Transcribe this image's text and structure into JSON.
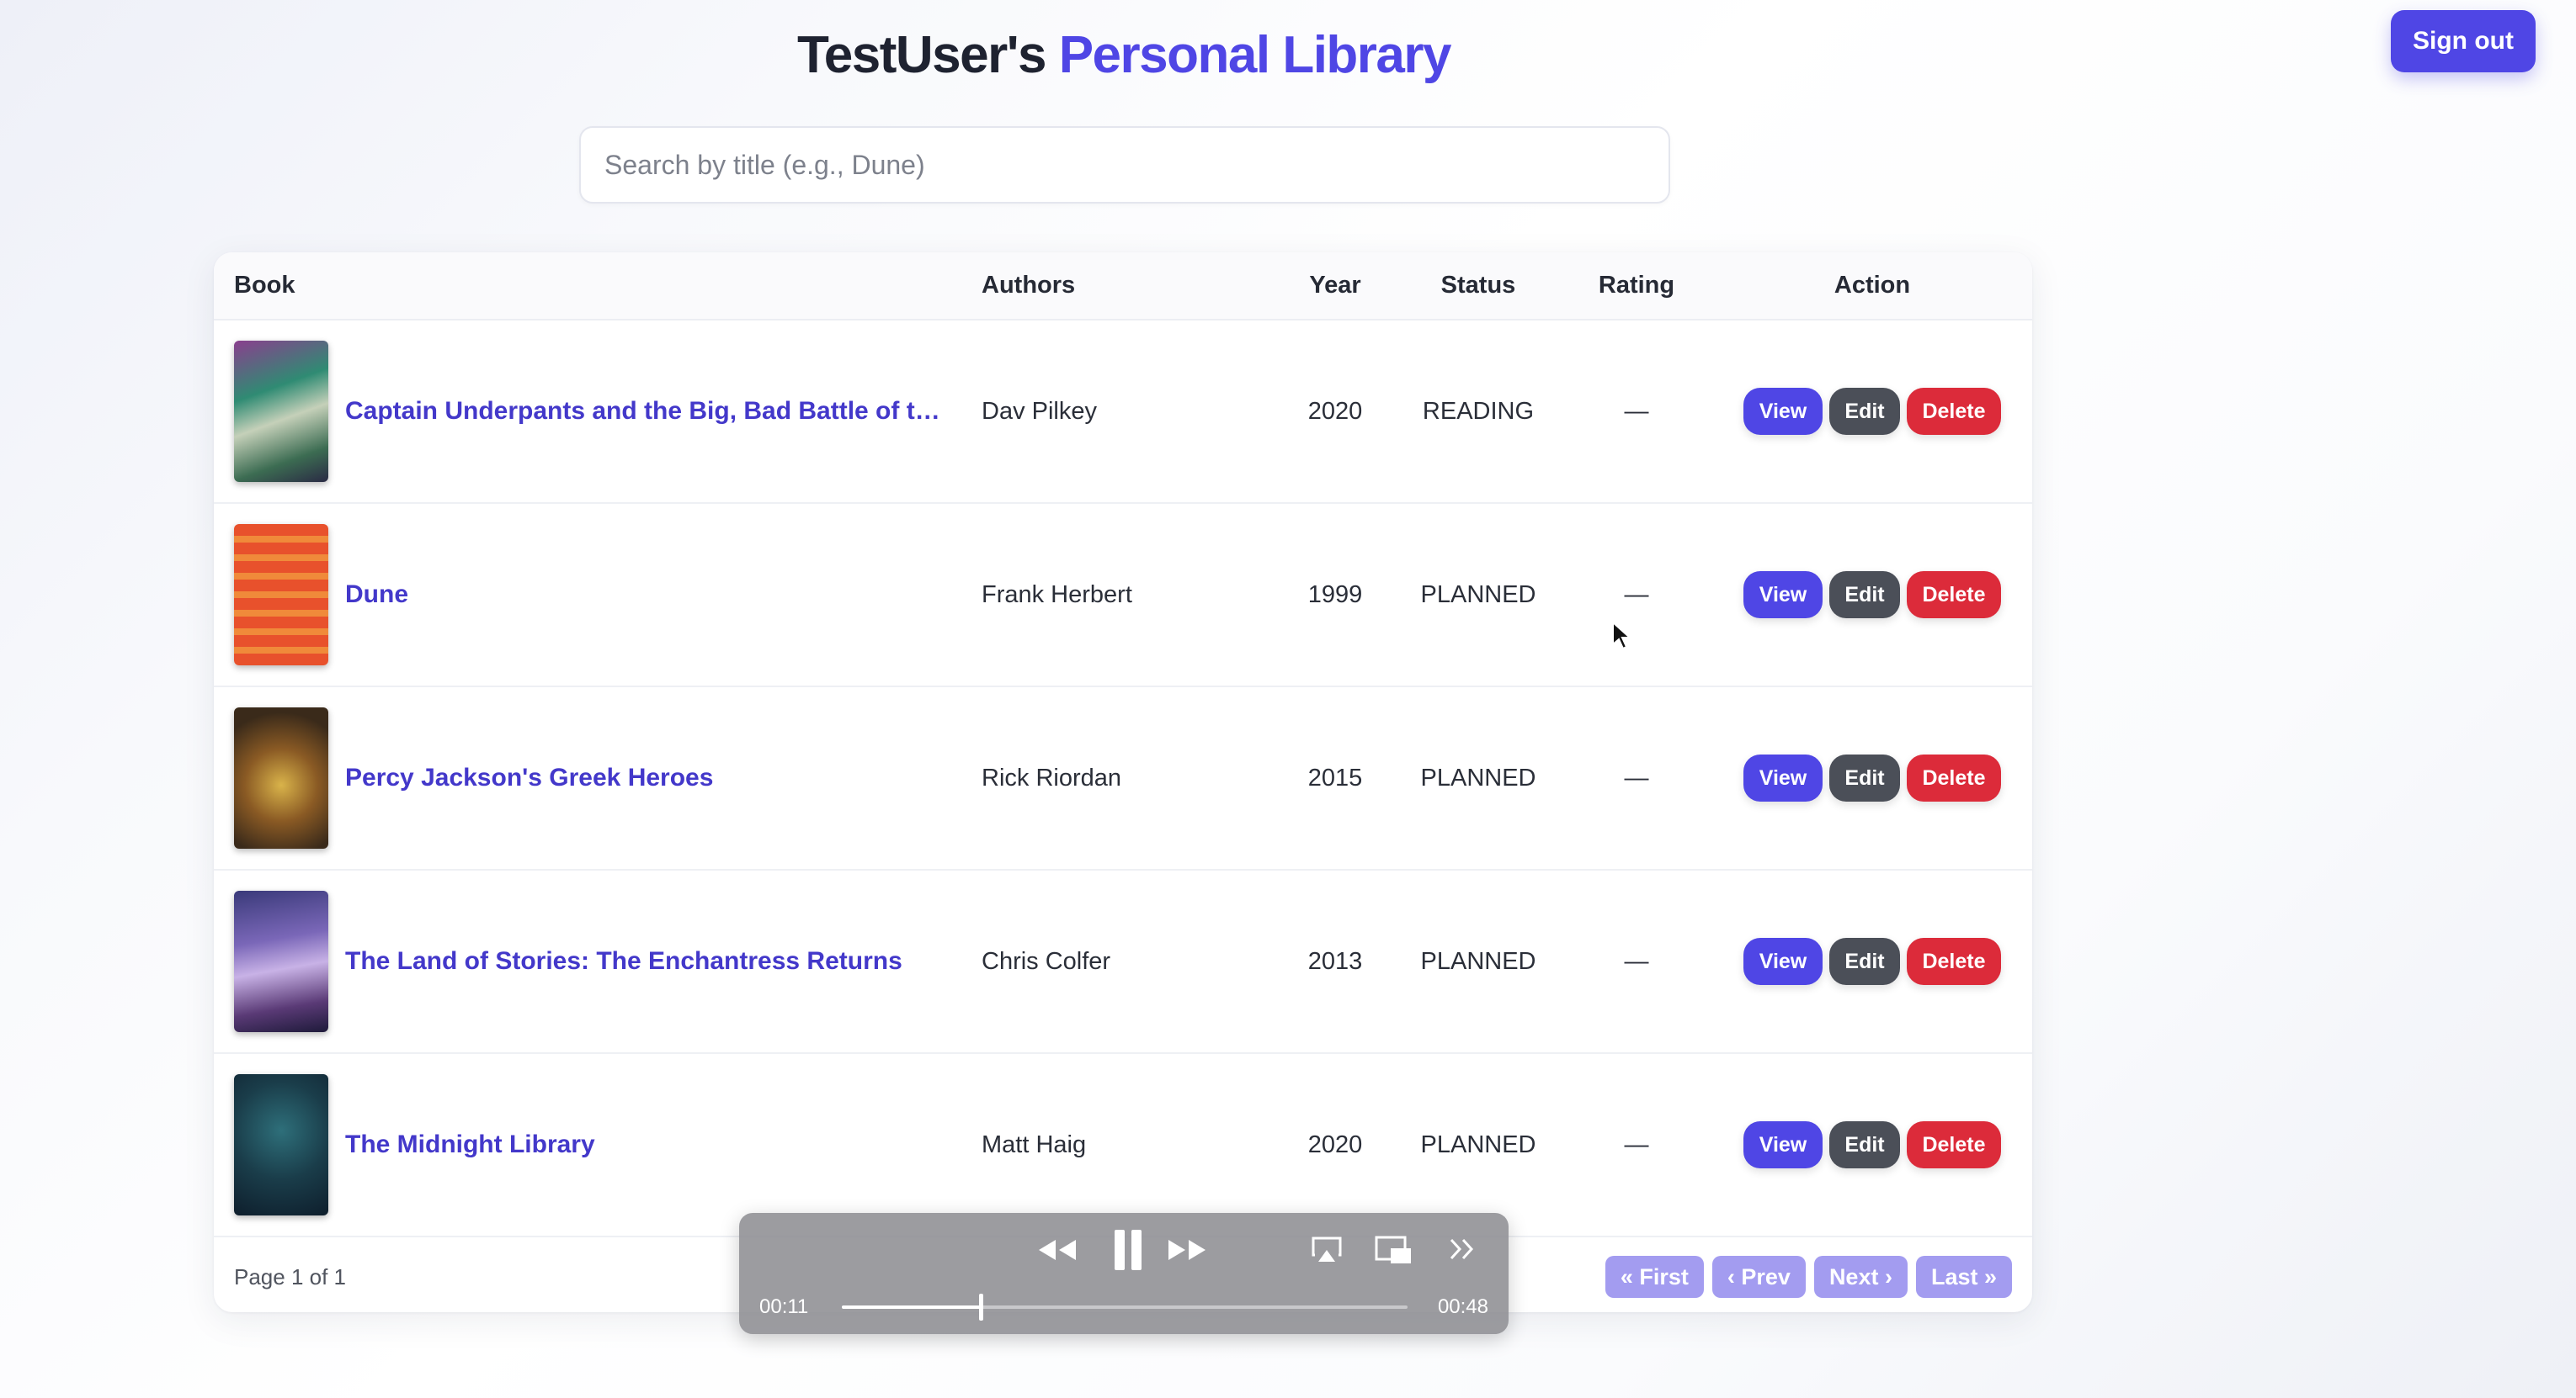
{
  "header": {
    "title_owner": "TestUser's",
    "title_accent": "Personal Library",
    "signout_label": "Sign out"
  },
  "search": {
    "placeholder": "Search by title (e.g., Dune)",
    "value": ""
  },
  "table": {
    "columns": {
      "book": "Book",
      "authors": "Authors",
      "year": "Year",
      "status": "Status",
      "rating": "Rating",
      "action": "Action"
    },
    "action_labels": {
      "view": "View",
      "edit": "Edit",
      "delete": "Delete"
    },
    "rows": [
      {
        "title": "Captain Underpants and the Big, Bad Battle of th…",
        "authors": "Dav Pilkey",
        "year": "2020",
        "status": "READING",
        "rating": "—"
      },
      {
        "title": "Dune",
        "authors": "Frank Herbert",
        "year": "1999",
        "status": "PLANNED",
        "rating": "—"
      },
      {
        "title": "Percy Jackson's Greek Heroes",
        "authors": "Rick Riordan",
        "year": "2015",
        "status": "PLANNED",
        "rating": "—"
      },
      {
        "title": "The Land of Stories: The Enchantress Returns",
        "authors": "Chris Colfer",
        "year": "2013",
        "status": "PLANNED",
        "rating": "—"
      },
      {
        "title": "The Midnight Library",
        "authors": "Matt Haig",
        "year": "2020",
        "status": "PLANNED",
        "rating": "—"
      }
    ]
  },
  "pagination": {
    "page_info": "Page 1 of 1",
    "first": "« First",
    "prev": "‹ Prev",
    "next": "Next ›",
    "last": "Last »"
  },
  "player": {
    "elapsed": "00:11",
    "total": "00:48",
    "progress": 0.245
  },
  "colors": {
    "accent": "#4f46e5",
    "title_link": "#4338ca",
    "edit": "#4b4f58",
    "delete": "#dc2b3a",
    "pager_disabled": "#a39cf0"
  },
  "icons": {
    "player": [
      "rewind-icon",
      "pause-icon",
      "fast-forward-icon",
      "airplay-icon",
      "picture-in-picture-icon",
      "more-icon"
    ],
    "pointer": "cursor-icon"
  }
}
